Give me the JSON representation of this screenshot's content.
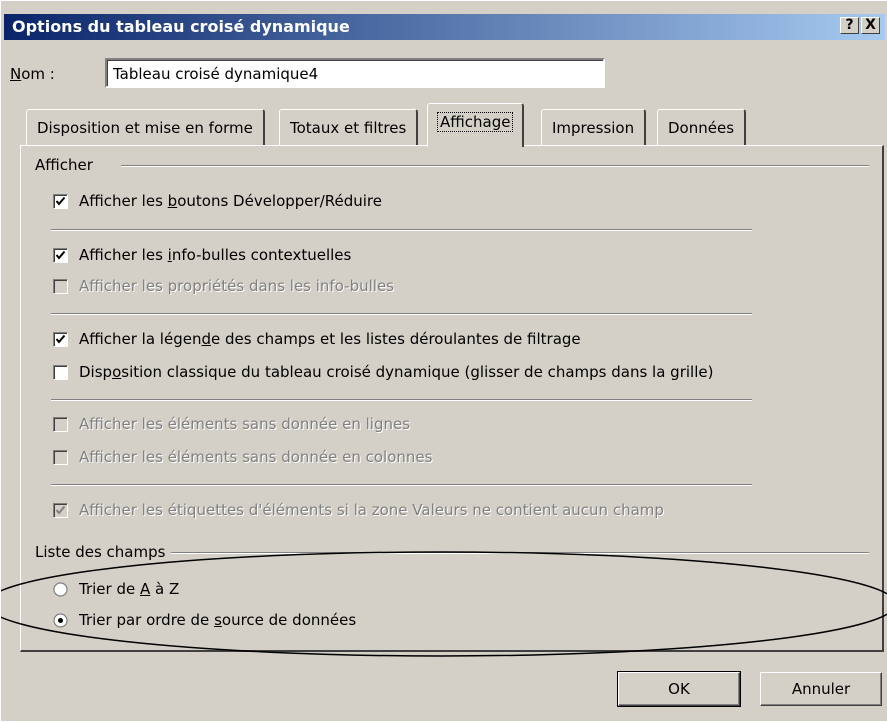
{
  "window": {
    "title": "Options du tableau croisé dynamique",
    "help_button": "?",
    "close_button": "X"
  },
  "name_field": {
    "label_pre": "",
    "label_accel": "N",
    "label_post": "om :",
    "value": "Tableau croisé dynamique4"
  },
  "tabs": [
    {
      "label": "Disposition et mise en forme",
      "active": false
    },
    {
      "label": "Totaux et filtres",
      "active": false
    },
    {
      "label": "Affichage",
      "active": true
    },
    {
      "label": "Impression",
      "active": false
    },
    {
      "label": "Données",
      "active": false
    }
  ],
  "afficher_group": {
    "label": "Afficher",
    "options": [
      {
        "pre": "Afficher les ",
        "accel": "b",
        "post": "outons Développer/Réduire",
        "checked": true,
        "enabled": true
      },
      {
        "pre": "Afficher les ",
        "accel": "i",
        "post": "nfo-bulles contextuelles",
        "checked": true,
        "enabled": true
      },
      {
        "pre": "Afficher les propriétés dans les info-bulles",
        "accel": "",
        "post": "",
        "checked": false,
        "enabled": false
      },
      {
        "pre": "Afficher la légen",
        "accel": "d",
        "post": "e des champs et les listes déroulantes de filtrage",
        "checked": true,
        "enabled": true
      },
      {
        "pre": "Disp",
        "accel": "o",
        "post": "sition classique du tableau croisé dynamique (glisser de champs dans la grille)",
        "checked": false,
        "enabled": true
      },
      {
        "pre": "Afficher les éléments sans donnée en lignes",
        "accel": "",
        "post": "",
        "checked": false,
        "enabled": false
      },
      {
        "pre": "Afficher les éléments sans donnée en colonnes",
        "accel": "",
        "post": "",
        "checked": false,
        "enabled": false
      },
      {
        "pre": "Afficher les étiquettes d'éléments si la zone Valeurs ne contient aucun champ",
        "accel": "",
        "post": "",
        "checked": true,
        "enabled": false
      }
    ]
  },
  "field_list_group": {
    "label": "Liste des champs",
    "options": [
      {
        "pre": "Trier de ",
        "accel": "A",
        "post": " à Z",
        "selected": false
      },
      {
        "pre": "Trier par ordre de ",
        "accel": "s",
        "post": "ource de données",
        "selected": true
      }
    ]
  },
  "buttons": {
    "ok": "OK",
    "cancel": "Annuler"
  },
  "colors": {
    "dialog_bg": "#d4d0c8",
    "title_start": "#0a246a",
    "title_end": "#a6caf0"
  }
}
